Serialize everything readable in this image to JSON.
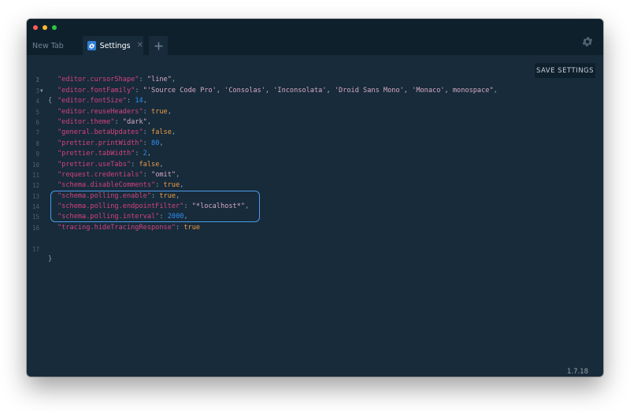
{
  "tabs": [
    {
      "label": "New Tab",
      "active": false
    },
    {
      "label": "Settings",
      "active": true
    }
  ],
  "toolbar": {
    "save_label": "SAVE SETTINGS"
  },
  "version": "1.7.18",
  "editor": {
    "open_brace": "{",
    "close_brace": "}",
    "lines": [
      {
        "key": "\"editor.cursorShape\"",
        "value": "\"line\"",
        "type": "string"
      },
      {
        "key": "\"editor.fontFamily\"",
        "value": "\"'Source Code Pro', 'Consolas', 'Inconsolata', 'Droid Sans Mono', 'Monaco', monospace\"",
        "type": "string"
      },
      {
        "key": "\"editor.fontSize\"",
        "value": "14",
        "type": "number"
      },
      {
        "key": "\"editor.reuseHeaders\"",
        "value": "true",
        "type": "bool"
      },
      {
        "key": "\"editor.theme\"",
        "value": "\"dark\"",
        "type": "string"
      },
      {
        "key": "\"general.betaUpdates\"",
        "value": "false",
        "type": "bool"
      },
      {
        "key": "\"prettier.printWidth\"",
        "value": "80",
        "type": "number"
      },
      {
        "key": "\"prettier.tabWidth\"",
        "value": "2",
        "type": "number"
      },
      {
        "key": "\"prettier.useTabs\"",
        "value": "false",
        "type": "bool"
      },
      {
        "key": "\"request.credentials\"",
        "value": "\"omit\"",
        "type": "string"
      },
      {
        "key": "\"schema.disableComments\"",
        "value": "true",
        "type": "bool"
      },
      {
        "key": "\"schema.polling.enable\"",
        "value": "true",
        "type": "bool"
      },
      {
        "key": "\"schema.polling.endpointFilter\"",
        "value": "\"*localhost*\"",
        "type": "string"
      },
      {
        "key": "\"schema.polling.interval\"",
        "value": "2000",
        "type": "number"
      },
      {
        "key": "\"tracing.hideTracingResponse\"",
        "value": "true",
        "type": "bool",
        "last": true
      }
    ],
    "line_numbers": [
      "1",
      "2",
      "3",
      "4",
      "5",
      "6",
      "7",
      "8",
      "9",
      "10",
      "11",
      "12",
      "13",
      "14",
      "15",
      "16",
      "17"
    ]
  },
  "colors": {
    "background": "#172b3a",
    "titlebar": "#0f202d",
    "key": "#d4427f",
    "string": "#d6a9c4",
    "boolean": "#ee9b48",
    "number": "#2f8df3",
    "highlight": "#4d9ae8",
    "traffic_red": "#ff5f57",
    "traffic_yellow": "#febc2e",
    "traffic_green": "#28c840"
  }
}
